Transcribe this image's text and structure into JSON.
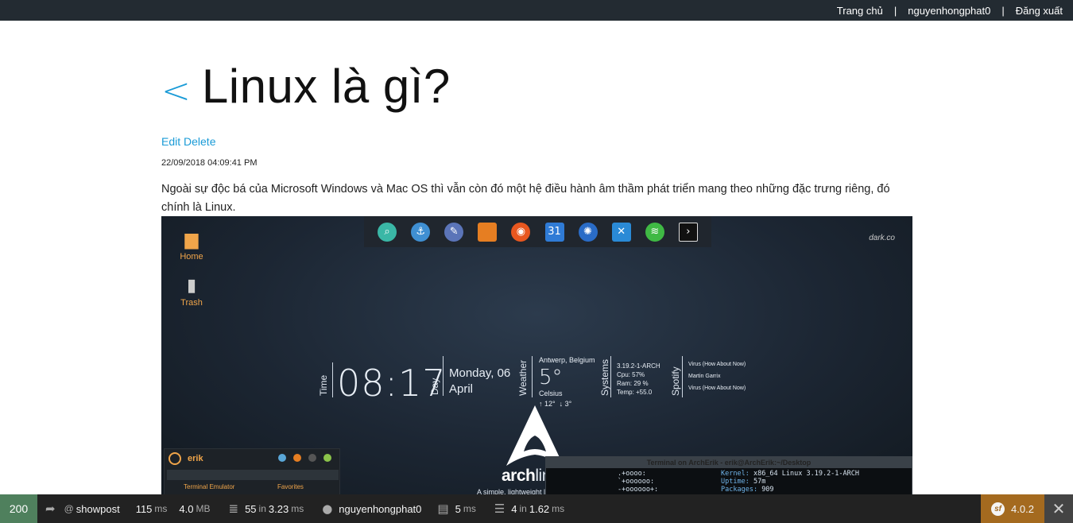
{
  "topnav": {
    "home": "Trang chủ",
    "separator": "|",
    "username": "nguyenhongphat0",
    "logout": "Đăng xuất"
  },
  "post": {
    "back_symbol": "<",
    "title": "Linux là gì?",
    "edit_label": "Edit",
    "delete_label": "Delete",
    "date": "22/09/2018 04:09:41 PM",
    "body": "Ngoài sự độc bá của Microsoft Windows và Mac OS thì vẫn còn đó một hệ điều hành âm thầm phát triển mang theo những đặc trưng riêng, đó chính là Linux."
  },
  "image": {
    "desktop_icons": [
      {
        "label": "Home",
        "icon": "folder-icon"
      },
      {
        "label": "Trash",
        "icon": "trash-icon"
      }
    ],
    "dock_icons": [
      "search-icon",
      "anchor-icon",
      "editor-icon",
      "folder-icon",
      "firefox-icon",
      "calendar-icon",
      "app-icon",
      "x-icon",
      "spotify-icon",
      "terminal-icon"
    ],
    "calendar_number": "31",
    "brandmark": "dark.co",
    "widget_time_label": "Time",
    "clock": "08:17",
    "widget_day_label": "Day",
    "day_line1": "Monday, 06",
    "day_line2": "April",
    "widget_weather_label": "Weather",
    "weather_location": "Antwerp, Belgium",
    "weather_temp": "5°",
    "weather_unit": "Celsius",
    "weather_hi": "↑ 12°",
    "weather_lo": "↓ 3°",
    "widget_systems_label": "Systems",
    "sys_kernel": "3.19.2-1-ARCH",
    "sys_cpu": "Cpu: 57%",
    "sys_ram": "Ram: 29 %",
    "sys_temp": "Temp: +55.0",
    "widget_spotify_label": "Spotify",
    "spotify_line1": "Virus (How About Now)",
    "spotify_line2": "Martin Garrix",
    "spotify_line3": "Virus (How About Now)",
    "arch_name_bold": "arch",
    "arch_name_thin": "linux",
    "arch_tagline": "A simple, lightweight linux distribution",
    "panel_user": "erik",
    "panel_menu1": "Terminal Emulator",
    "panel_menu2": "Favorites",
    "terminal_title": "Terminal on ArchErik - erik@ArchErik:~/Desktop",
    "terminal_lines": [
      {
        "art": ".+oooo:",
        "key": "Kernel:",
        "val": "x86_64 Linux 3.19.2-1-ARCH"
      },
      {
        "art": "`+oooooo:",
        "key": "Uptime:",
        "val": "57m"
      },
      {
        "art": "-+oooooo+:",
        "key": "Packages:",
        "val": "909"
      }
    ]
  },
  "debugbar": {
    "status": "200",
    "route_at": "@",
    "route": "showpost",
    "time_value": "115",
    "time_unit": "ms",
    "memory_value": "4.0",
    "memory_unit": "MB",
    "cache_value": "55",
    "cache_in": "in",
    "cache_time": "3.23",
    "cache_unit": "ms",
    "user": "nguyenhongphat0",
    "twig_value": "5",
    "twig_unit": "ms",
    "db_value": "4",
    "db_in": "in",
    "db_time": "1.62",
    "db_unit": "ms",
    "version": "4.0.2",
    "close_symbol": "✕"
  },
  "colors": {
    "topbar_bg": "#232b32",
    "link": "#1a9bd7",
    "status_ok": "#4f805d",
    "symfony_orange": "#a46a1f"
  }
}
